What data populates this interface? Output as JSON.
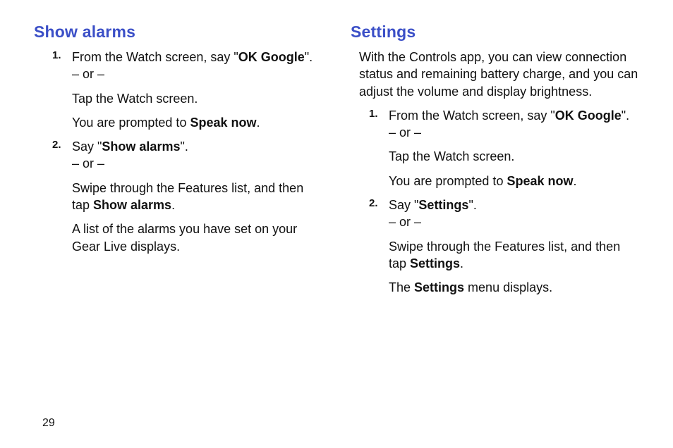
{
  "pageNumber": "29",
  "left": {
    "heading": "Show alarms",
    "items": [
      {
        "line1_pre": "From the Watch screen, say \"",
        "line1_bold": "OK Google",
        "line1_post": "\".",
        "or": "– or –",
        "line2": "Tap the Watch screen.",
        "line3_pre": "You are prompted to ",
        "line3_bold": "Speak now",
        "line3_post": "."
      },
      {
        "line1_pre": "Say \"",
        "line1_bold": "Show alarms",
        "line1_post": "\".",
        "or": "– or –",
        "line2_pre": "Swipe through the Features list, and then tap ",
        "line2_bold": "Show alarms",
        "line2_post": ".",
        "line3": "A list of the alarms you have set on your Gear Live displays."
      }
    ]
  },
  "right": {
    "heading": "Settings",
    "intro": "With the Controls app, you can view connection status and remaining battery charge, and you can adjust the volume and display brightness.",
    "items": [
      {
        "line1_pre": "From the Watch screen, say \"",
        "line1_bold": "OK Google",
        "line1_post": "\".",
        "or": "– or –",
        "line2": "Tap the Watch screen.",
        "line3_pre": "You are prompted to ",
        "line3_bold": "Speak now",
        "line3_post": "."
      },
      {
        "line1_pre": "Say \"",
        "line1_bold": "Settings",
        "line1_post": "\".",
        "or": "– or –",
        "line2_pre": "Swipe through the Features list, and then tap ",
        "line2_bold": "Settings",
        "line2_post": ".",
        "line3_pre": "The ",
        "line3_bold": "Settings",
        "line3_post": " menu displays."
      }
    ]
  }
}
